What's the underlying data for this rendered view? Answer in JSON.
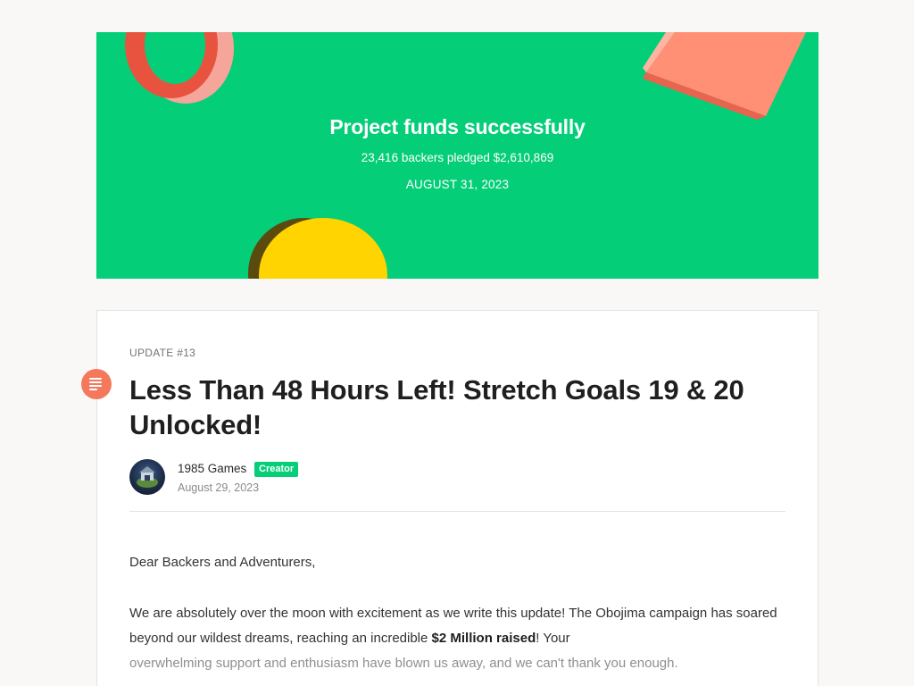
{
  "banner": {
    "title": "Project funds successfully",
    "subtitle": "23,416 backers pledged $2,610,869",
    "date": "AUGUST 31, 2023",
    "background_color": "#05ce78"
  },
  "post": {
    "update_number": "UPDATE #13",
    "title": "Less Than 48 Hours Left! Stretch Goals 19 & 20 Unlocked!",
    "author": {
      "name": "1985 Games",
      "badge": "Creator",
      "avatar_icon": "game-logo-avatar"
    },
    "date": "August 29, 2023",
    "icon": "document-lines-icon",
    "body": {
      "greeting": "Dear Backers and Adventurers,",
      "para_part1": "We are absolutely over the moon with excitement as we write this update! The Obojima campaign has soared beyond our wildest dreams, reaching an incredible ",
      "para_bold": "$2 Million raised",
      "para_part2": "! Your",
      "para_faded": "overwhelming support and enthusiasm have blown us away, and we can't thank you enough."
    }
  },
  "colors": {
    "accent_green": "#05ce78",
    "post_icon_orange": "#f4785c"
  }
}
